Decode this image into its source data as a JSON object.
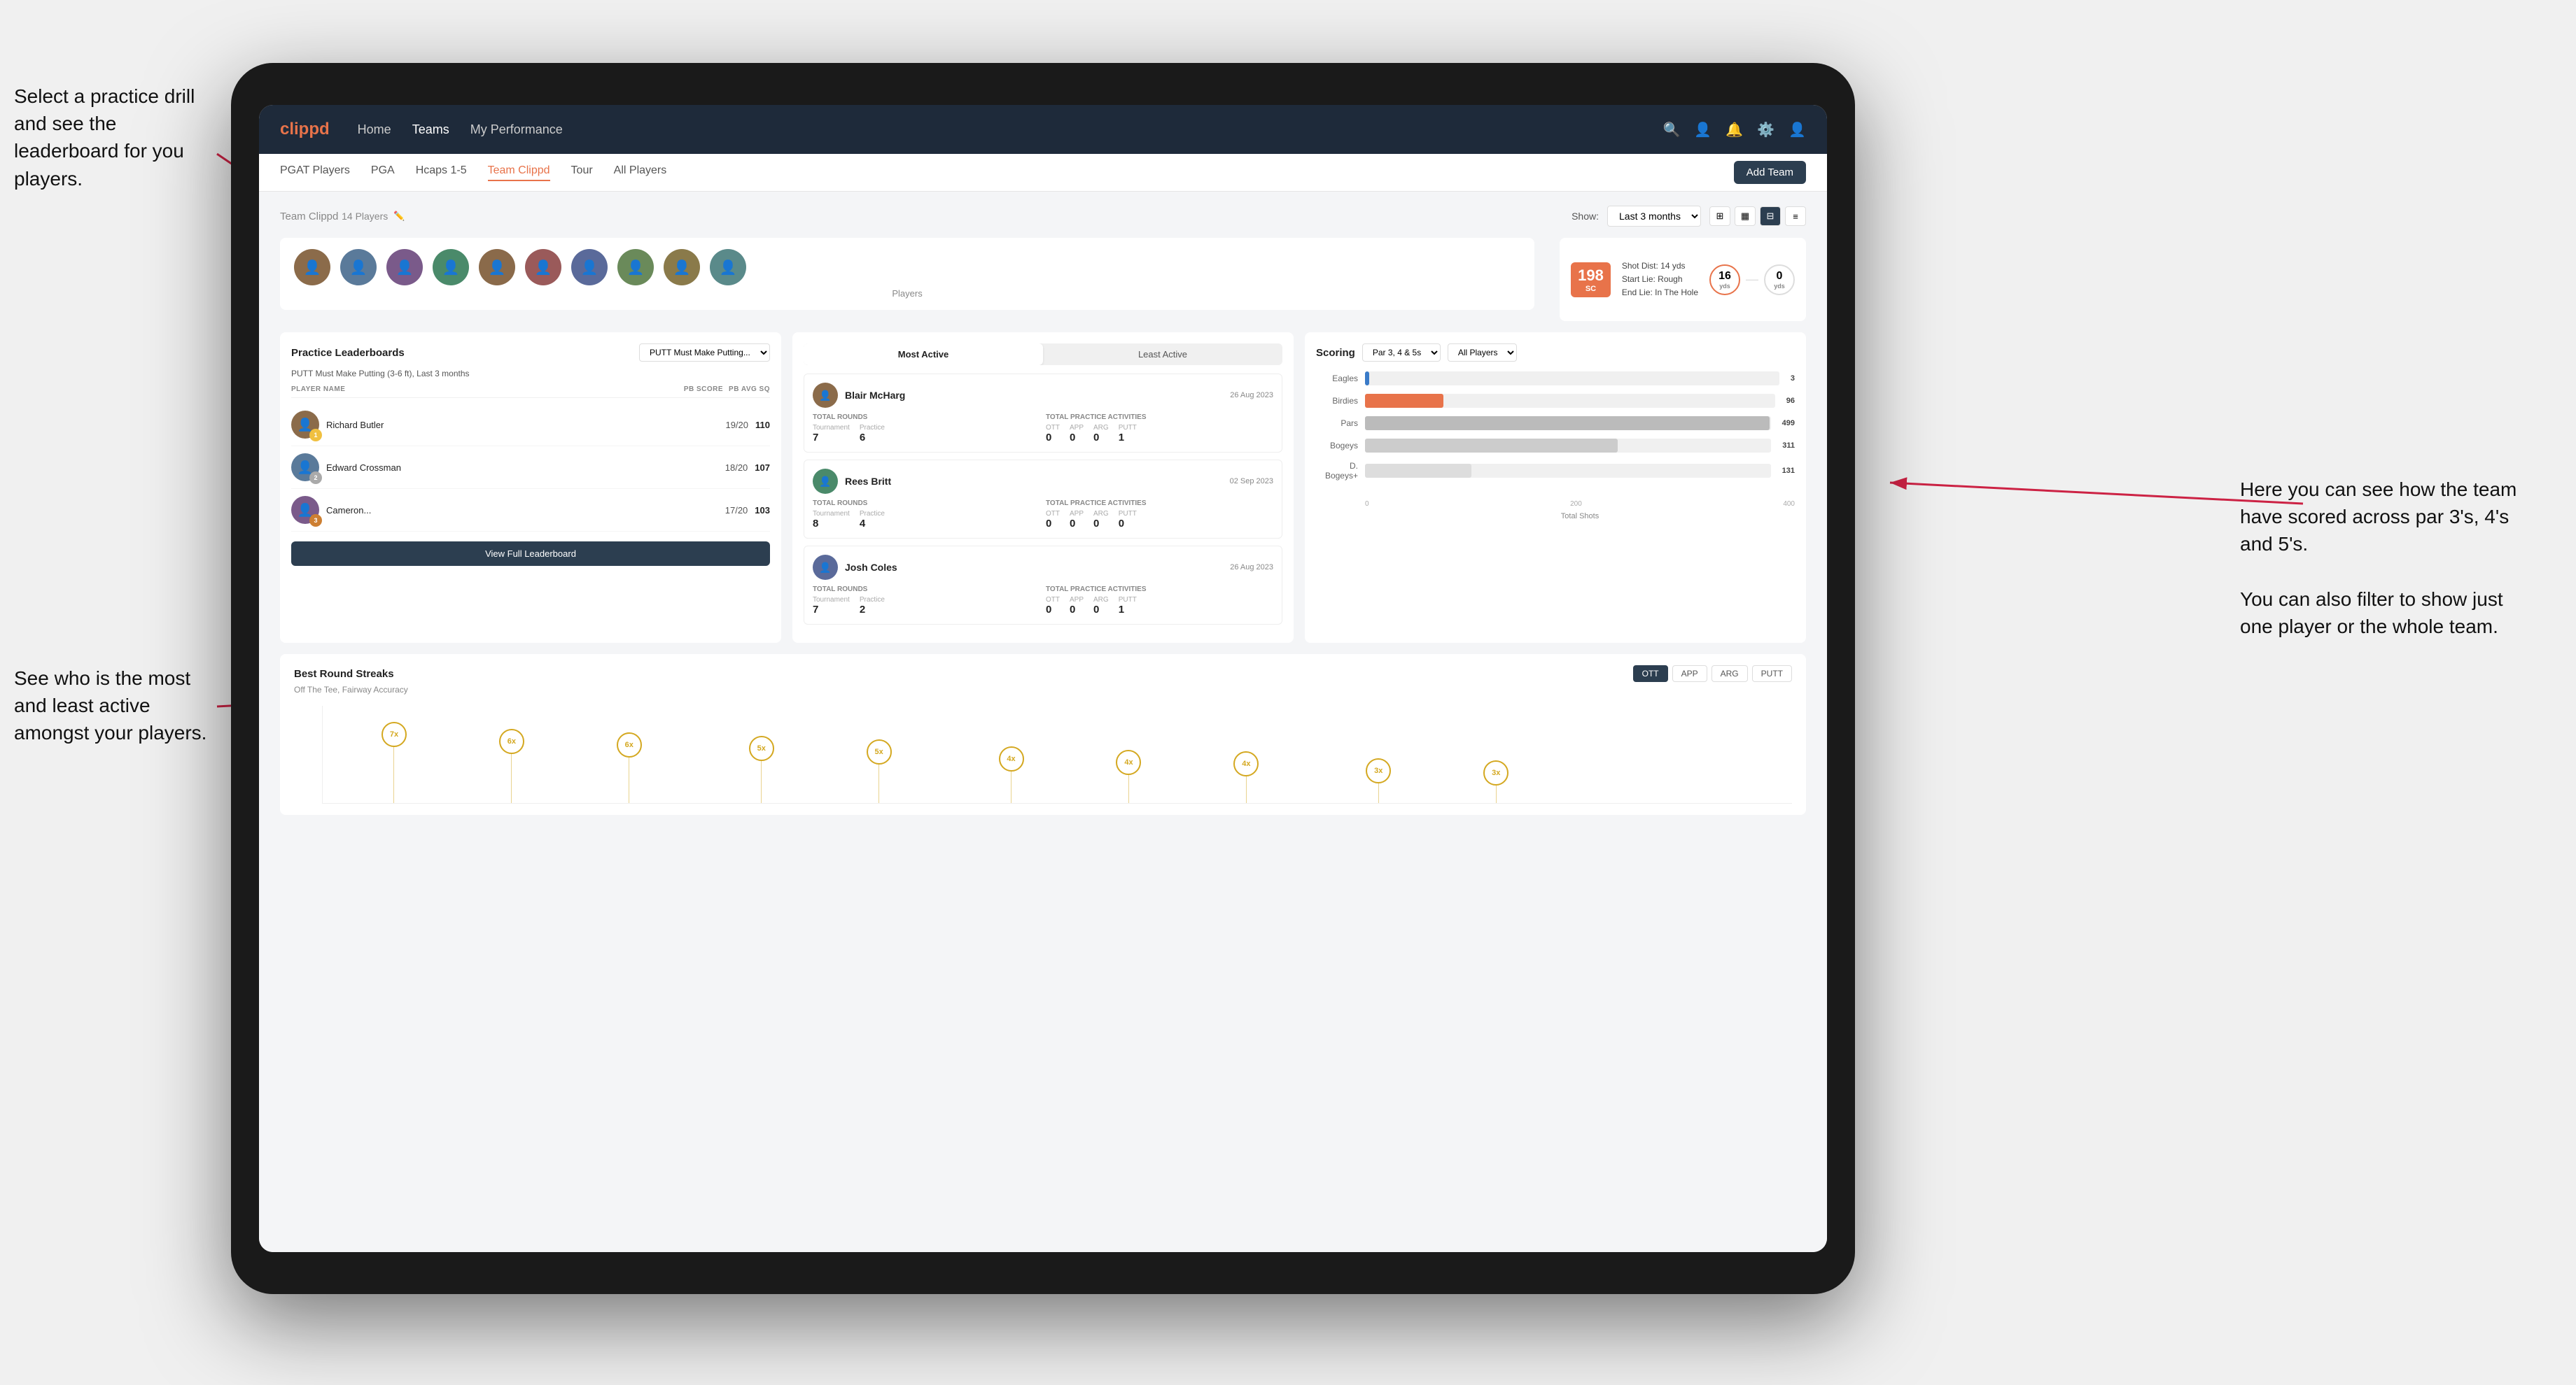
{
  "annotations": {
    "top_left": "Select a practice drill and see the leaderboard for you players.",
    "bottom_left": "See who is the most and least active amongst your players.",
    "right": "Here you can see how the team have scored across par 3's, 4's and 5's.\n\nYou can also filter to show just one player or the whole team."
  },
  "navbar": {
    "logo": "clippd",
    "links": [
      "Home",
      "Teams",
      "My Performance"
    ],
    "active_link": "Teams"
  },
  "sub_navbar": {
    "links": [
      "PGAT Players",
      "PGA",
      "Hcaps 1-5",
      "Team Clippd",
      "Tour",
      "All Players"
    ],
    "active_link": "Team Clippd",
    "add_team_btn": "Add Team"
  },
  "team_header": {
    "title": "Team Clippd",
    "player_count": "14 Players",
    "show_label": "Show:",
    "period": "Last 3 months",
    "view_modes": [
      "grid-small",
      "grid-medium",
      "grid-large",
      "list"
    ]
  },
  "shot_info": {
    "badge_value": "198",
    "badge_unit": "SC",
    "details_line1": "Shot Dist: 14 yds",
    "details_line2": "Start Lie: Rough",
    "details_line3": "End Lie: In The Hole",
    "circle1_value": "16",
    "circle1_unit": "yds",
    "circle2_value": "0",
    "circle2_unit": "yds"
  },
  "practice_leaderboards": {
    "title": "Practice Leaderboards",
    "drill_name": "PUTT Must Make Putting...",
    "subtitle": "PUTT Must Make Putting (3-6 ft), Last 3 months",
    "col_player": "PLAYER NAME",
    "col_score": "PB SCORE",
    "col_avg": "PB AVG SQ",
    "players": [
      {
        "rank": 1,
        "name": "Richard Butler",
        "score": "19/20",
        "avg": "110",
        "badge": "gold",
        "badge_num": "1"
      },
      {
        "rank": 2,
        "name": "Edward Crossman",
        "score": "18/20",
        "avg": "107",
        "badge": "silver",
        "badge_num": "2"
      },
      {
        "rank": 3,
        "name": "Cameron...",
        "score": "17/20",
        "avg": "103",
        "badge": "bronze",
        "badge_num": "3"
      }
    ],
    "view_btn": "View Full Leaderboard"
  },
  "active_panel": {
    "toggle_most": "Most Active",
    "toggle_least": "Least Active",
    "active_tab": "most",
    "players": [
      {
        "name": "Blair McHarg",
        "date": "26 Aug 2023",
        "total_rounds_label": "Total Rounds",
        "tournament": "7",
        "practice": "6",
        "total_practice_label": "Total Practice Activities",
        "ott": "0",
        "app": "0",
        "arg": "0",
        "putt": "1"
      },
      {
        "name": "Rees Britt",
        "date": "02 Sep 2023",
        "total_rounds_label": "Total Rounds",
        "tournament": "8",
        "practice": "4",
        "total_practice_label": "Total Practice Activities",
        "ott": "0",
        "app": "0",
        "arg": "0",
        "putt": "0"
      },
      {
        "name": "Josh Coles",
        "date": "26 Aug 2023",
        "total_rounds_label": "Total Rounds",
        "tournament": "7",
        "practice": "2",
        "total_practice_label": "Total Practice Activities",
        "ott": "0",
        "app": "0",
        "arg": "0",
        "putt": "1"
      }
    ]
  },
  "scoring": {
    "title": "Scoring",
    "filter1": "Par 3, 4 & 5s",
    "filter2": "All Players",
    "bars": [
      {
        "label": "Eagles",
        "value": 3,
        "max": 500,
        "color": "#2196F3",
        "display": "3"
      },
      {
        "label": "Birdies",
        "value": 96,
        "max": 500,
        "color": "#e8734a",
        "display": "96"
      },
      {
        "label": "Pars",
        "value": 499,
        "max": 500,
        "color": "#aaa",
        "display": "499"
      },
      {
        "label": "Bogeys",
        "value": 311,
        "max": 500,
        "color": "#ccc",
        "display": "311"
      },
      {
        "label": "D. Bogeys+",
        "value": 131,
        "max": 500,
        "color": "#ddd",
        "display": "131"
      }
    ],
    "x_axis": [
      "0",
      "200",
      "400"
    ],
    "x_label": "Total Shots"
  },
  "best_round_streaks": {
    "title": "Best Round Streaks",
    "subtitle": "Off The Tee, Fairway Accuracy",
    "filters": [
      "OTT",
      "APP",
      "ARG",
      "PUTT"
    ],
    "active_filter": "OTT",
    "dots": [
      {
        "x": 4,
        "label": "7x",
        "line_height": 80
      },
      {
        "x": 12,
        "label": "6x",
        "line_height": 70
      },
      {
        "x": 20,
        "label": "6x",
        "line_height": 65
      },
      {
        "x": 29,
        "label": "5x",
        "line_height": 60
      },
      {
        "x": 37,
        "label": "5x",
        "line_height": 55
      },
      {
        "x": 46,
        "label": "4x",
        "line_height": 45
      },
      {
        "x": 54,
        "label": "4x",
        "line_height": 40
      },
      {
        "x": 62,
        "label": "4x",
        "line_height": 38
      },
      {
        "x": 71,
        "label": "3x",
        "line_height": 28
      },
      {
        "x": 79,
        "label": "3x",
        "line_height": 25
      }
    ]
  }
}
